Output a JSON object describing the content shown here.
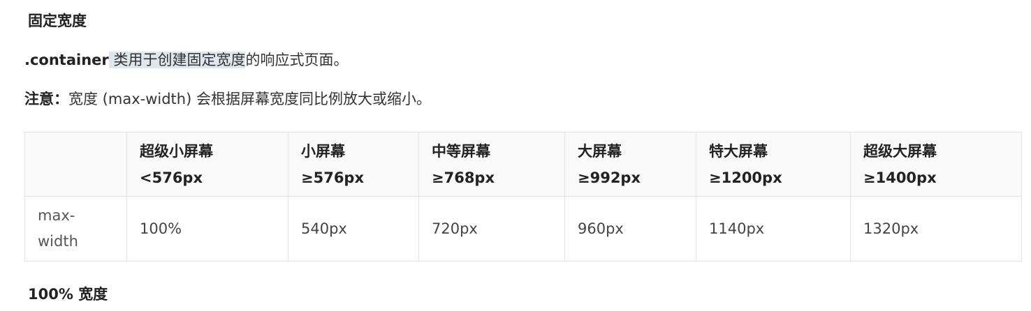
{
  "sections": {
    "fixed_width_title": "固定宽度",
    "full_width_title": "100% 宽度"
  },
  "intro": {
    "code": ".container",
    "highlight": " 类用于创建固定宽度",
    "rest": "的响应式页面。"
  },
  "note": {
    "label": "注意：",
    "text": "宽度 (max-width) 会根据屏幕宽度同比例放大或缩小。"
  },
  "table": {
    "headers": [
      {
        "name": "",
        "size": ""
      },
      {
        "name": "超级小屏幕",
        "size": "<576px"
      },
      {
        "name": "小屏幕",
        "size": "≥576px"
      },
      {
        "name": "中等屏幕",
        "size": "≥768px"
      },
      {
        "name": "大屏幕",
        "size": "≥992px"
      },
      {
        "name": "特大屏幕",
        "size": "≥1200px"
      },
      {
        "name": "超级大屏幕",
        "size": "≥1400px"
      }
    ],
    "row": {
      "label_line1": "max-",
      "label_line2": "width",
      "values": [
        "100%",
        "540px",
        "720px",
        "960px",
        "1140px",
        "1320px"
      ]
    }
  }
}
